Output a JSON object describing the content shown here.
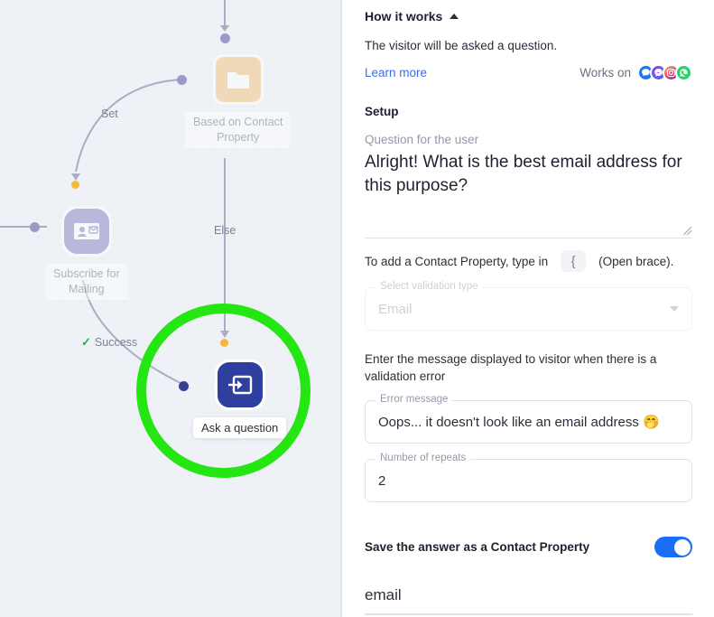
{
  "canvas": {
    "nodes": [
      {
        "id": "contact-property",
        "label": "Based on Contact\nProperty",
        "icon": "folder-icon",
        "icon_color": "#f2c789",
        "active": false
      },
      {
        "id": "subscribe",
        "label": "Subscribe for\nMailing",
        "icon": "contact-card-icon",
        "icon_color": "#8b8bc8",
        "active": false
      },
      {
        "id": "ask",
        "label": "Ask a question",
        "icon": "login-arrow-icon",
        "icon_color": "#2f3fa0",
        "active": true
      }
    ],
    "edge_labels": {
      "set": "Set",
      "else": "Else",
      "success": "Success"
    },
    "highlight_color": "#25e512",
    "background_color": "#eef1f5"
  },
  "panel": {
    "how_it_works": {
      "title": "How it works",
      "toggle_icon": "caret-up-icon",
      "description": "The visitor will be asked a question.",
      "learn_more": "Learn more",
      "works_on_label": "Works on",
      "channels": [
        {
          "name": "web-chat-icon",
          "color": "#1877f2"
        },
        {
          "name": "messenger-icon",
          "color": "#a334fa"
        },
        {
          "name": "instagram-icon",
          "color": "#e1306c"
        },
        {
          "name": "whatsapp-icon",
          "color": "#25d366"
        }
      ]
    },
    "setup": {
      "heading": "Setup",
      "question_label": "Question for the user",
      "question_value": "Alright! What is the best email address for this purpose?",
      "hint_prefix": "To add a Contact Property, type in",
      "hint_brace": "{",
      "hint_suffix": "(Open brace).",
      "validation": {
        "legend": "Select validation type",
        "value": "Email",
        "caret_icon": "chevron-down-icon",
        "disabled": true
      },
      "error_helper": "Enter the message displayed to visitor when there is a validation error",
      "error_message": {
        "legend": "Error message",
        "value": "Oops... it doesn't look like an email address 🤭"
      },
      "repeats": {
        "legend": "Number of repeats",
        "value": "2"
      },
      "save_answer": {
        "label": "Save the answer as a Contact Property",
        "toggle_on": true,
        "toggle_color": "#1a6ef5"
      },
      "contact_property_value": "email"
    }
  }
}
